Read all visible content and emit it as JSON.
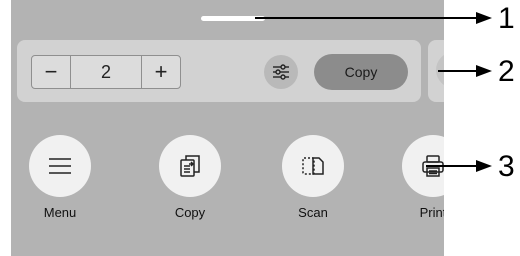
{
  "copies_stepper": {
    "minus": "−",
    "value": "2",
    "plus": "+"
  },
  "copy_button": {
    "label": "Copy"
  },
  "apps": [
    {
      "label": "Menu",
      "icon": "menu-icon"
    },
    {
      "label": "Copy",
      "icon": "copy-icon"
    },
    {
      "label": "Scan",
      "icon": "scan-icon"
    },
    {
      "label": "Print",
      "icon": "print-icon"
    }
  ],
  "callouts": [
    "1",
    "2",
    "3"
  ]
}
